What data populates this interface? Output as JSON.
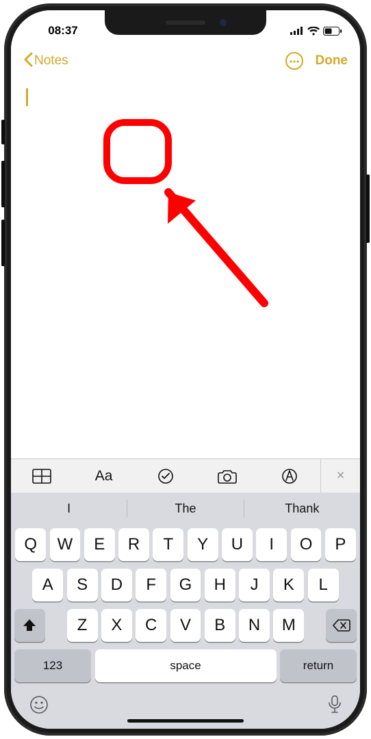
{
  "status": {
    "time": "08:37"
  },
  "nav": {
    "back_label": "Notes",
    "done_label": "Done"
  },
  "toolbar": {
    "table_name": "table-icon",
    "format_label": "Aa",
    "checklist_name": "checklist-icon",
    "camera_name": "camera-icon",
    "markup_name": "markup-icon",
    "close_label": "×"
  },
  "suggestions": [
    "I",
    "The",
    "Thank"
  ],
  "keyboard": {
    "row1": [
      "Q",
      "W",
      "E",
      "R",
      "T",
      "Y",
      "U",
      "I",
      "O",
      "P"
    ],
    "row2": [
      "A",
      "S",
      "D",
      "F",
      "G",
      "H",
      "J",
      "K",
      "L"
    ],
    "row3": [
      "Z",
      "X",
      "C",
      "V",
      "B",
      "N",
      "M"
    ],
    "num_label": "123",
    "space_label": "space",
    "return_label": "return"
  },
  "annotation": {
    "color": "#ff0000"
  }
}
